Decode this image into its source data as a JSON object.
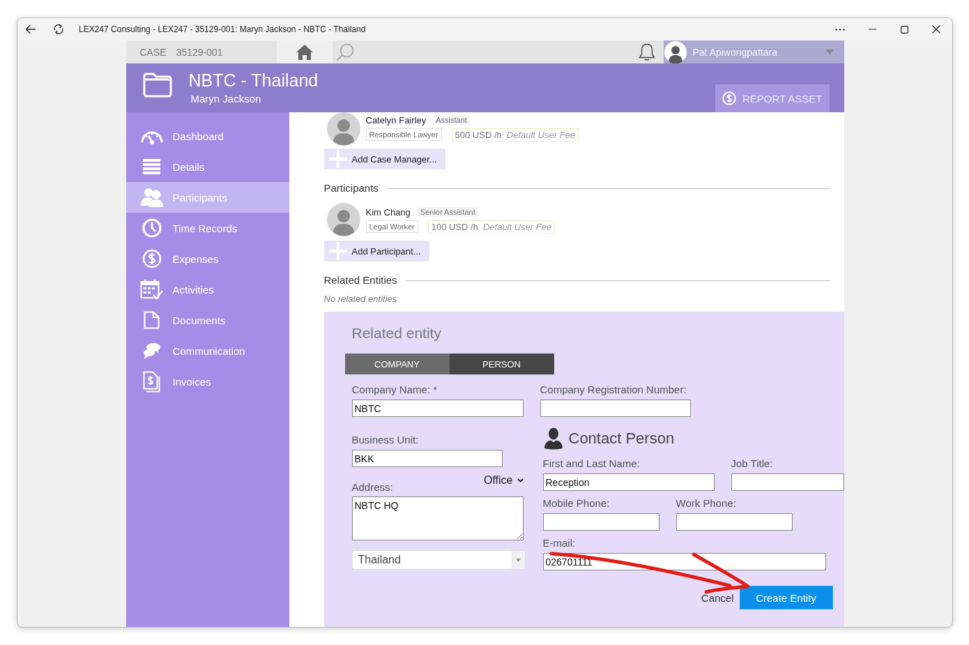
{
  "window": {
    "title": "LEX247 Consulting - LEX247 - 35129-001: Maryn Jackson - NBTC - Thailand"
  },
  "topbar": {
    "case_label": "CASE",
    "case_number": "35129-001",
    "user_name": "Pat Apiwongpattara"
  },
  "header": {
    "title": "NBTC - Thailand",
    "subtitle": "Maryn Jackson",
    "action_button": "REPORT ASSET"
  },
  "sidebar": {
    "items": [
      {
        "label": "Dashboard",
        "selected": false
      },
      {
        "label": "Details",
        "selected": false
      },
      {
        "label": "Participants",
        "selected": true
      },
      {
        "label": "Time Records",
        "selected": false
      },
      {
        "label": "Expenses",
        "selected": false
      },
      {
        "label": "Activities",
        "selected": false
      },
      {
        "label": "Documents",
        "selected": false
      },
      {
        "label": "Communication",
        "selected": false
      },
      {
        "label": "Invoices",
        "selected": false
      }
    ]
  },
  "case_managers": {
    "people": [
      {
        "name": "Catelyn Fairley",
        "title": "Assistant",
        "role": "Responsible Lawyer",
        "rate": "500 USD /h",
        "rate_note": "Default User Fee"
      }
    ],
    "add_button": "Add Case Manager..."
  },
  "participants": {
    "heading": "Participants",
    "people": [
      {
        "name": "Kim Chang",
        "title": "Senior Assistant",
        "role": "Legal Worker",
        "rate": "100 USD /h",
        "rate_note": "Default User Fee"
      }
    ],
    "add_button": "Add Participant..."
  },
  "related_entities": {
    "heading": "Related Entities",
    "empty_text": "No related entities"
  },
  "entity_form": {
    "title": "Related entity",
    "tabs": [
      {
        "label": "COMPANY",
        "selected": true
      },
      {
        "label": "PERSON",
        "selected": false
      }
    ],
    "company_name": {
      "label": "Company Name: *",
      "value": "NBTC"
    },
    "registration_number": {
      "label": "Company Registration Number:"
    },
    "business_unit": {
      "label": "Business Unit:",
      "value": "BKK"
    },
    "address": {
      "label": "Address:",
      "type": "Office",
      "value": "NBTC HQ"
    },
    "country": {
      "value": "Thailand"
    },
    "contact_person": {
      "title": "Contact Person",
      "full_name": {
        "label": "First and Last Name:",
        "value": "Reception"
      },
      "job_title": {
        "label": "Job Title:"
      },
      "mobile_phone": {
        "label": "Mobile Phone:"
      },
      "work_phone": {
        "label": "Work Phone:"
      },
      "email": {
        "label": "E-mail:",
        "value": "026701111"
      }
    },
    "cancel_button": "Cancel",
    "create_button": "Create Entity"
  }
}
